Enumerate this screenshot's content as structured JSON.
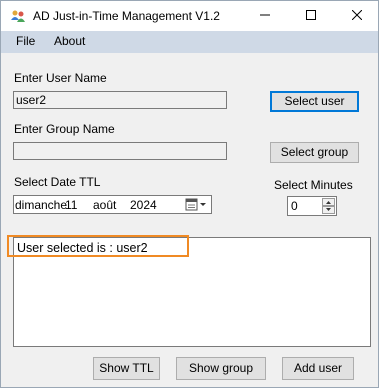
{
  "window": {
    "title": "AD Just-in-Time Management V1.2",
    "icon": "people-icon"
  },
  "titlebar_buttons": {
    "minimize": "minimize-icon",
    "maximize": "maximize-icon",
    "close": "close-icon"
  },
  "menu": [
    "File",
    "About"
  ],
  "user": {
    "label": "Enter User Name",
    "value": "user2",
    "button": "Select user"
  },
  "group": {
    "label": "Enter Group Name",
    "value": "",
    "button": "Select group"
  },
  "date": {
    "label": "Select Date TTL",
    "weekday": "dimanche",
    "day": "11",
    "month": "août",
    "year": "2024",
    "icon": "calendar-dropdown-icon"
  },
  "minutes": {
    "label": "Select Minutes",
    "value": "0"
  },
  "output": {
    "text": "User selected is : user2"
  },
  "bottom_buttons": {
    "show_ttl": "Show TTL",
    "show_group": "Show group",
    "add_user": "Add user"
  },
  "colors": {
    "menubar": "#cfd9e6",
    "highlight": "#f08a24",
    "default_button_border": "#0078d7"
  }
}
